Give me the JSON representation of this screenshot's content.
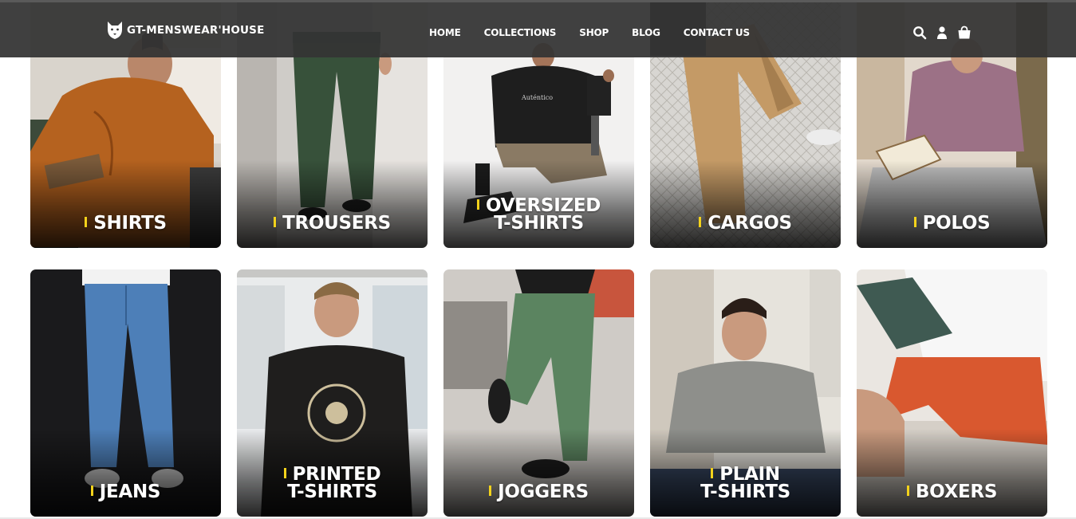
{
  "brand": {
    "name": "GT-MENSWEAR'HOUSE",
    "logo_icon": "wolf-head-icon"
  },
  "nav": [
    "HOME",
    "COLLECTIONS",
    "SHOP",
    "BLOG",
    "CONTACT US"
  ],
  "header_icons": [
    "search-icon",
    "user-icon",
    "shopping-bag-icon"
  ],
  "colors": {
    "header_bg": "#343434",
    "accent_bar": "#f3d21b",
    "label_text": "#ffffff"
  },
  "categories": [
    {
      "id": "shirts",
      "line1": "SHIRTS",
      "line2": ""
    },
    {
      "id": "trousers",
      "line1": "TROUSERS",
      "line2": ""
    },
    {
      "id": "oversized-t-shirts",
      "line1": "OVERSIZED",
      "line2": "T-SHIRTS"
    },
    {
      "id": "cargos",
      "line1": "CARGOS",
      "line2": ""
    },
    {
      "id": "polos",
      "line1": "POLOS",
      "line2": ""
    },
    {
      "id": "jeans",
      "line1": "JEANS",
      "line2": ""
    },
    {
      "id": "printed-t-shirts",
      "line1": "PRINTED",
      "line2": "T-SHIRTS"
    },
    {
      "id": "joggers",
      "line1": "JOGGERS",
      "line2": ""
    },
    {
      "id": "plain-t-shirts",
      "line1": "PLAIN",
      "line2": "T-SHIRTS"
    },
    {
      "id": "boxers",
      "line1": "BOXERS",
      "line2": ""
    }
  ]
}
